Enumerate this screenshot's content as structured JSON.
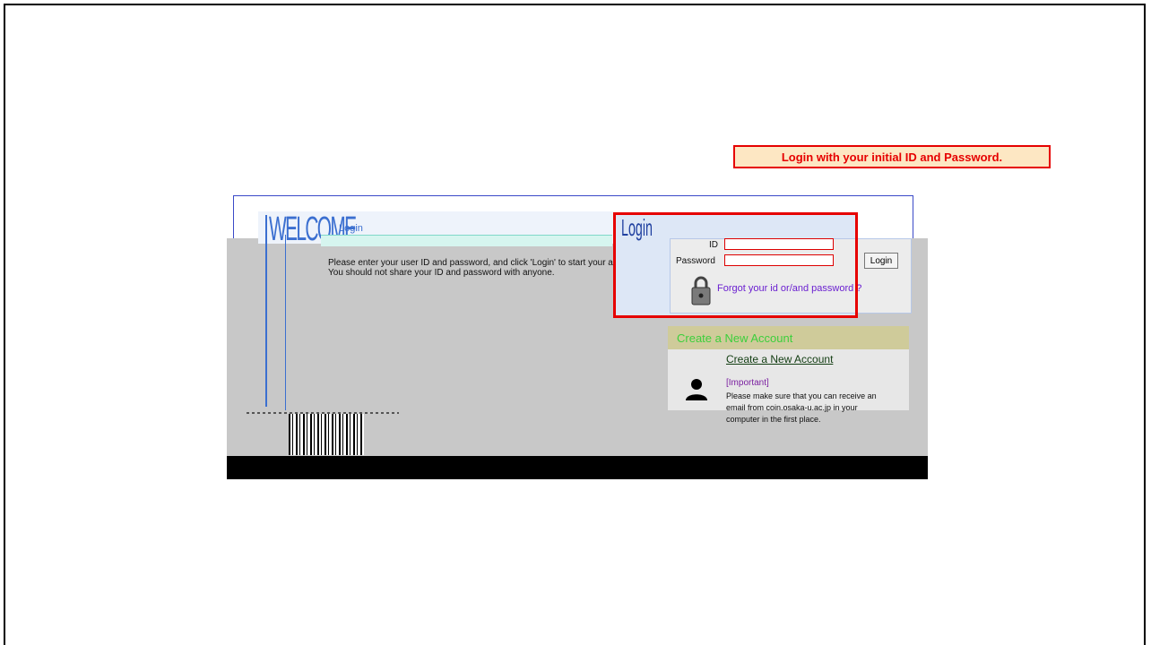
{
  "callout": {
    "text": "Login with your initial ID and Password."
  },
  "welcome": {
    "title": "WELCOME",
    "subtitle": "Login",
    "description": [
      "Please enter your user ID and password, and click 'Login' to start your application.",
      "You should not share your ID and password with anyone."
    ]
  },
  "login": {
    "title": "Login",
    "id_label": "ID",
    "password_label": "Password",
    "button_label": "Login",
    "forgot_link": "Forgot your id or/and password ?"
  },
  "account": {
    "header": "Create a New Account",
    "link": "Create a New Account",
    "important_label": "[Important]",
    "important_text": [
      "Please make sure that you can receive an",
      "email from coin.osaka-u.ac.jp in your",
      "computer in the first place."
    ]
  },
  "colors": {
    "highlight": "#e60000",
    "callout_bg": "#fde7c3",
    "accent_blue": "#3b6fd0",
    "account_header_text": "#3ccf3c",
    "link_purple": "#6a1fd0"
  }
}
